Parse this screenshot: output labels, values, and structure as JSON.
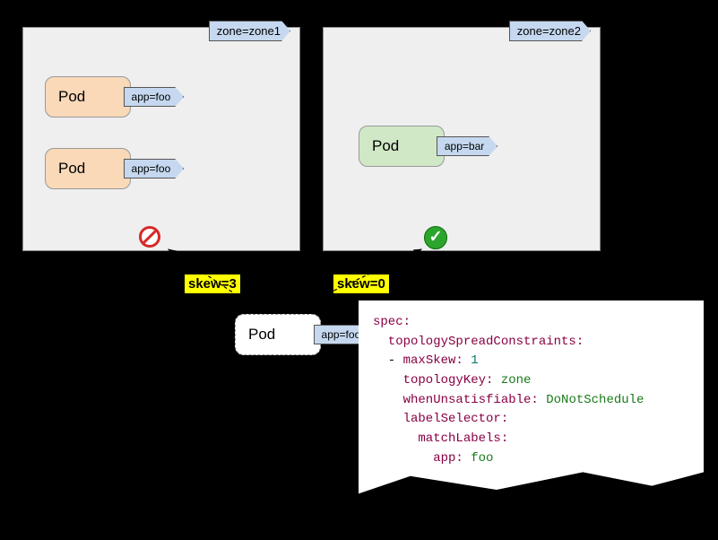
{
  "zones": {
    "zone1_label": "zone=zone1",
    "zone2_label": "zone=zone2"
  },
  "pods": {
    "pod1_text": "Pod",
    "pod1_label": "app=foo",
    "pod2_text": "Pod",
    "pod2_label": "app=foo",
    "pod3_text": "Pod",
    "pod3_label": "app=bar",
    "pod4_text": "Pod",
    "pod4_label": "app=foo"
  },
  "skew": {
    "left": "skew=3",
    "right": "skew=0"
  },
  "code": {
    "l1_k": "spec:",
    "l2_k": "  topologySpreadConstraints:",
    "l3_pre": "  - ",
    "l3_k": "maxSkew:",
    "l3_v": " 1",
    "l4_k": "    topologyKey:",
    "l4_v": " zone",
    "l5_k": "    whenUnsatisfiable:",
    "l5_v": " DoNotSchedule",
    "l6_k": "    labelSelector:",
    "l7_k": "      matchLabels:",
    "l8_k": "        app:",
    "l8_v": " foo"
  }
}
